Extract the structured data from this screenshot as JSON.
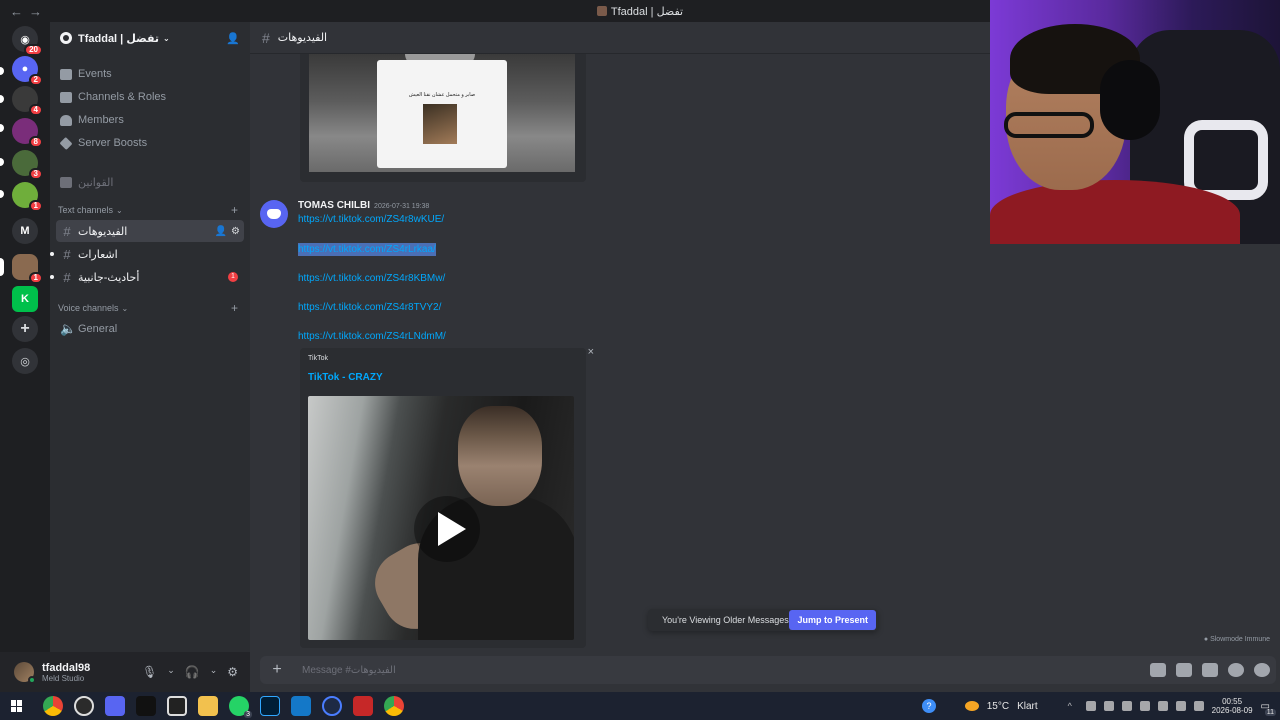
{
  "window": {
    "title": "Tfaddal | تفضل"
  },
  "server": {
    "name": "Tfaddal | تفضل",
    "menu": [
      {
        "label": "Events",
        "icon": "calendar-icon"
      },
      {
        "label": "Channels & Roles",
        "icon": "list-icon"
      },
      {
        "label": "Members",
        "icon": "members-icon"
      },
      {
        "label": "Server Boosts",
        "icon": "boost-icon"
      }
    ],
    "rules_channel": "القوانين",
    "text_category": "Text channels",
    "voice_category": "Voice channels",
    "text_channels": [
      {
        "name": "الفيديوهات",
        "active": true
      },
      {
        "name": "اشعارات",
        "active": false
      },
      {
        "name": "أحاديث-جانبية",
        "active": false,
        "unread": "1"
      }
    ],
    "voice_channels": [
      {
        "name": "General"
      }
    ]
  },
  "rail": {
    "badges": [
      "20",
      "2",
      "4",
      "8",
      "3",
      "1",
      "1"
    ],
    "letter_server": "M"
  },
  "channel_header": {
    "name": "الفيديوهات"
  },
  "embed_top": {
    "caption": "صابر و متحمل عشان نقنا العيش"
  },
  "message": {
    "author": "TOMAS CHILBI",
    "timestamp": "2026-07-31 19:38",
    "links": [
      "https://vt.tiktok.com/ZS4r8wKUE/",
      "https://vt.tiktok.com/ZS4rLrkaa/",
      "https://vt.tiktok.com/ZS4r8KBMw/",
      "https://vt.tiktok.com/ZS4r8TVY2/",
      "https://vt.tiktok.com/ZS4rLNdmM/"
    ],
    "selected_link_index": 1
  },
  "embed": {
    "provider": "TikTok",
    "title": "TikTok - CRAZY",
    "close": "×"
  },
  "older": {
    "label": "You're Viewing Older Messages",
    "jump_label": "Jump to Present"
  },
  "slowmode": "Slowmode Immune",
  "composer": {
    "placeholder": "Message #الفيديوهات"
  },
  "user": {
    "name": "tfaddal98",
    "status": "Meld Studio"
  },
  "taskbar": {
    "weather_temp": "15°C",
    "weather_text": "Klart",
    "time": "00:55",
    "date": "2026-08-09",
    "notif_count": "11",
    "help": "?",
    "whatsapp_badge": "3"
  }
}
